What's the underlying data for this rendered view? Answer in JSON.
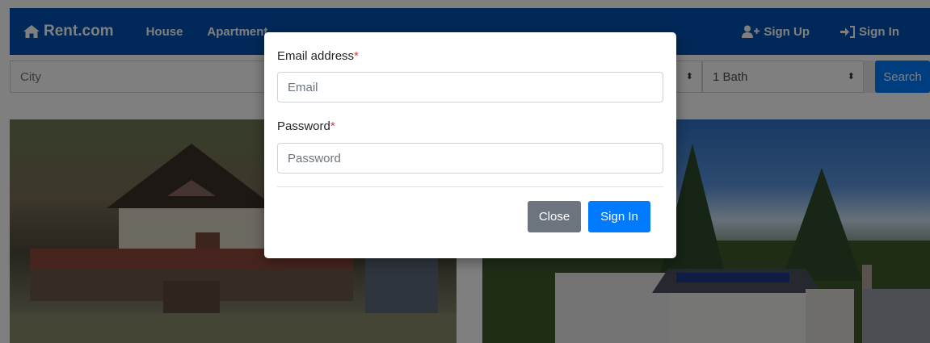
{
  "navbar": {
    "brand": "Rent.com",
    "links": [
      "House",
      "Apartment"
    ],
    "sign_up": "Sign Up",
    "sign_in": "Sign In"
  },
  "search": {
    "city_placeholder": "City",
    "bath_value": "1 Bath",
    "button": "Search"
  },
  "modal": {
    "email_label": "Email address",
    "email_placeholder": "Email",
    "password_label": "Password",
    "password_placeholder": "Password",
    "required_mark": "*",
    "close_button": "Close",
    "signin_button": "Sign In"
  },
  "colors": {
    "navbar": "#0053b3",
    "primary": "#007bff",
    "secondary": "#6c757d",
    "required": "#dc3545"
  },
  "icons": [
    "home-icon",
    "user-plus-icon",
    "sign-in-icon",
    "select-arrow-icon"
  ]
}
